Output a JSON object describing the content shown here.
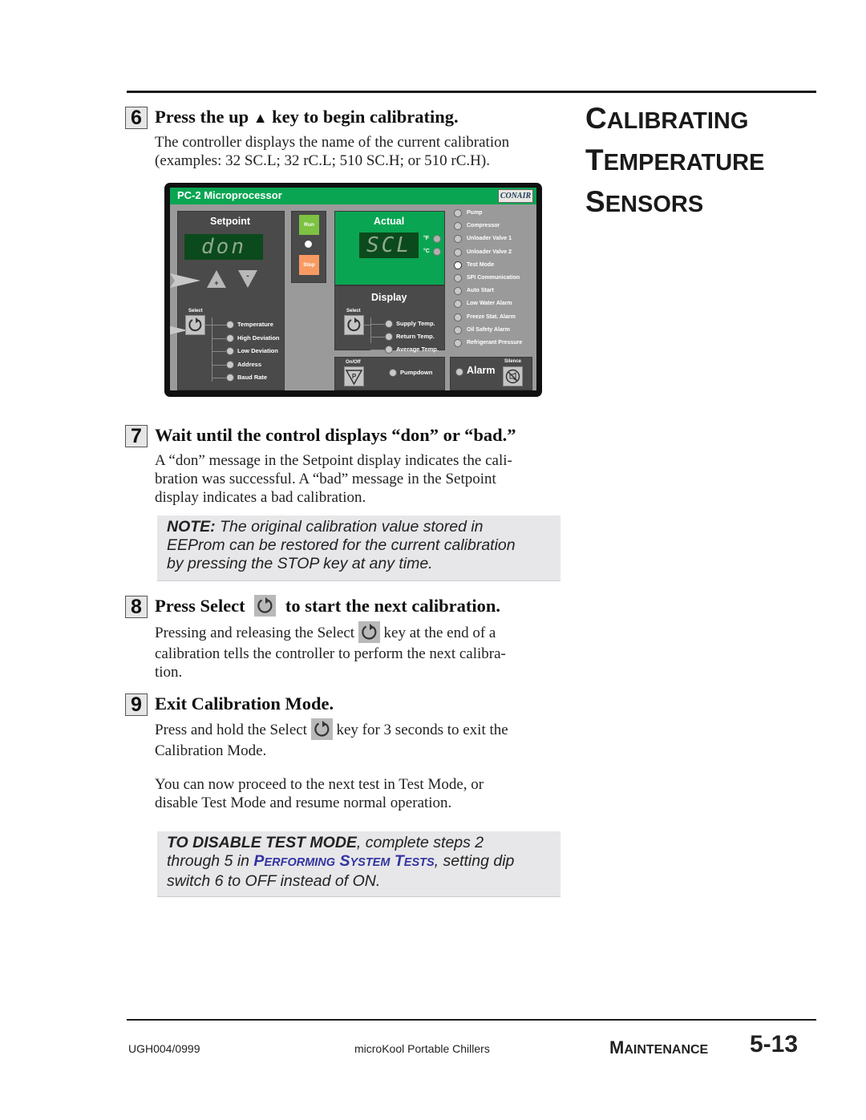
{
  "page": {
    "section_title": [
      "Calibrating",
      "Temperature",
      "Sensors"
    ],
    "footer": {
      "doc_code": "UGH004/0999",
      "product": "microKool Portable Chillers",
      "section": "Maintenance",
      "page_number": "5-13"
    }
  },
  "steps": [
    {
      "number": "6",
      "title_parts": [
        "Press the up ",
        "▲",
        " key to begin calibrating."
      ],
      "body": [
        "The controller displays the name of the current calibration",
        "(examples: 32  SC.L; 32  rC.L; 510  SC.H; or 510 rC.H)."
      ]
    },
    {
      "number": "7",
      "title": "Wait until the control displays “don” or “bad.”",
      "body": [
        "A “don” message in the Setpoint display indicates the cali-",
        "bration was successful. A “bad” message in the Setpoint",
        "display indicates a bad calibration."
      ],
      "note": {
        "label": "NOTE:",
        "lines": [
          " The original calibration value stored in",
          "EEProm can be restored for the current calibration",
          "by pressing the STOP key at any time."
        ]
      }
    },
    {
      "number": "8",
      "title_before": "Press Select",
      "title_after": "to start the next calibration.",
      "body_line1_before": "Pressing and releasing the Select",
      "body_line1_after": "key at the end of a",
      "body": [
        "calibration tells the controller to perform the next calibra-",
        "tion."
      ]
    },
    {
      "number": "9",
      "title": "Exit Calibration Mode.",
      "body_line1_before": "Press and hold the Select",
      "body_line1_after": "key for 3 seconds to exit the",
      "body_line2": "Calibration Mode.",
      "para2": [
        "You can now proceed to the next test in Test Mode, or",
        "disable Test Mode and resume normal operation."
      ],
      "note": {
        "label": "TO DISABLE TEST MODE",
        "line1_rest": ", complete steps 2",
        "line2_before": "through 5 in ",
        "link_text": "Performing System Tests",
        "line2_after": ", setting dip",
        "line3": "switch 6 to OFF instead of ON."
      }
    }
  ],
  "controller": {
    "title": "PC-2 Microprocessor",
    "brand": "CONAIR",
    "setpoint": {
      "label": "Setpoint",
      "display": "don",
      "plus_label": "+",
      "minus_label": "-",
      "select_label": "Select",
      "options": [
        "Temperature",
        "High Deviation",
        "Low Deviation",
        "Address",
        "Baud Rate"
      ]
    },
    "run_label": "Run",
    "stop_label": "Stop",
    "actual": {
      "label": "Actual",
      "display": "SCL",
      "unit_f": "°F",
      "unit_c": "°C"
    },
    "display_group": {
      "label": "Display",
      "select_label": "Select",
      "options": [
        "Supply Temp.",
        "Return Temp.",
        "Average Temp."
      ]
    },
    "pump": {
      "onoff_label": "On/Off",
      "key_glyph": "P",
      "status": "Pumpdown"
    },
    "status_leds": [
      {
        "label": "Pump",
        "on": false
      },
      {
        "label": "Compressor",
        "on": false
      },
      {
        "label": "Unloader Valve 1",
        "on": false
      },
      {
        "label": "Unloader Valve 2",
        "on": false
      },
      {
        "label": "Test Mode",
        "on": true
      },
      {
        "label": "SPI Communication",
        "on": false
      },
      {
        "label": "Auto Start",
        "on": false
      },
      {
        "label": "Low Water Alarm",
        "on": false
      },
      {
        "label": "Freeze Stat. Alarm",
        "on": false
      },
      {
        "label": "Oil Safety Alarm",
        "on": false
      },
      {
        "label": "Refrigerant Pressure",
        "on": false
      }
    ],
    "alarm": {
      "label": "Alarm",
      "silence_label": "Silence"
    },
    "colors": {
      "header_green": "#0aa552",
      "run_green": "#7dc242",
      "stop_orange": "#f79a62",
      "lcd_bg": "#0b4a1c"
    }
  }
}
